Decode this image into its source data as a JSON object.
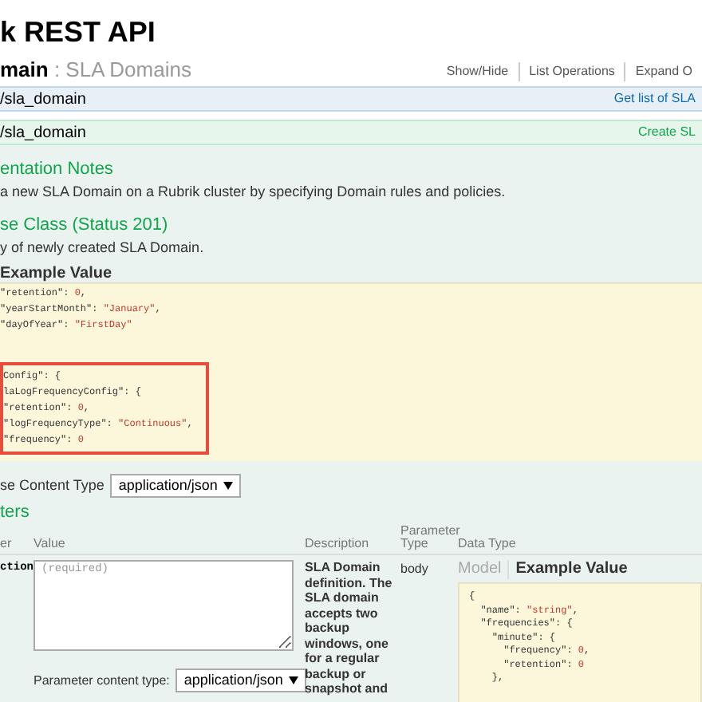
{
  "page_title": "k REST API",
  "resource": {
    "name": "main",
    "description": " : SLA Domains",
    "links": [
      "Show/Hide",
      "List Operations",
      "Expand O"
    ]
  },
  "operations": [
    {
      "kind": "get",
      "path": "/sla_domain",
      "summary": "Get list of SLA"
    },
    {
      "kind": "post",
      "path": "/sla_domain",
      "summary": "Create SL"
    }
  ],
  "notes": {
    "heading": "entation Notes",
    "text": "a new SLA Domain on a Rubrik cluster by specifying Domain rules and policies."
  },
  "response_class": {
    "heading": "se Class (Status 201)",
    "text": "y of newly created SLA Domain.",
    "tab": {
      "label": "Example Value",
      "selected": true
    },
    "code_sections": [
      {
        "highlighted": false,
        "lines": [
          {
            "key": "\"retention\": ",
            "value": "0",
            "tail": ","
          },
          {
            "key": "\"yearStartMonth\": ",
            "value": "\"January\"",
            "tail": ","
          },
          {
            "key": "\"dayOfYear\": ",
            "value": "\"FirstDay\""
          }
        ]
      },
      {
        "highlighted": true,
        "lines": [
          {
            "key": "Config\": {"
          },
          {
            "key": "laLogFrequencyConfig\": {"
          },
          {
            "key": "\"retention\": ",
            "value": "0",
            "tail": ","
          },
          {
            "key": "\"logFrequencyType\": ",
            "value": "\"Continuous\"",
            "tail": ","
          },
          {
            "key": "\"frequency\": ",
            "value": "0"
          }
        ]
      }
    ]
  },
  "content_type": {
    "label": "se Content Type",
    "value": "application/json"
  },
  "parameters": {
    "heading": "ters",
    "columns": [
      "er",
      "Value",
      "Description",
      "Parameter Type",
      "Data Type"
    ],
    "rows": [
      {
        "name": "ction",
        "placeholder": "(required)",
        "content_type_label": "Parameter content type:",
        "content_type": "application/json",
        "description": "SLA Domain definition. The SLA domain accepts two backup windows, one for a regular backup or snapshot and",
        "param_type": "body",
        "tabs": [
          {
            "label": "Model",
            "selected": false
          },
          {
            "label": "Example Value",
            "selected": true
          }
        ],
        "example": [
          {
            "key": "{"
          },
          {
            "key": "  \"name\": ",
            "value": "\"string\"",
            "tail": ","
          },
          {
            "key": "  \"frequencies\": {"
          },
          {
            "key": "    \"minute\": {"
          },
          {
            "key": "      \"frequency\": ",
            "value": "0",
            "tail": ","
          },
          {
            "key": "      \"retention\": ",
            "value": "0"
          },
          {
            "key": "    },"
          }
        ]
      }
    ]
  }
}
